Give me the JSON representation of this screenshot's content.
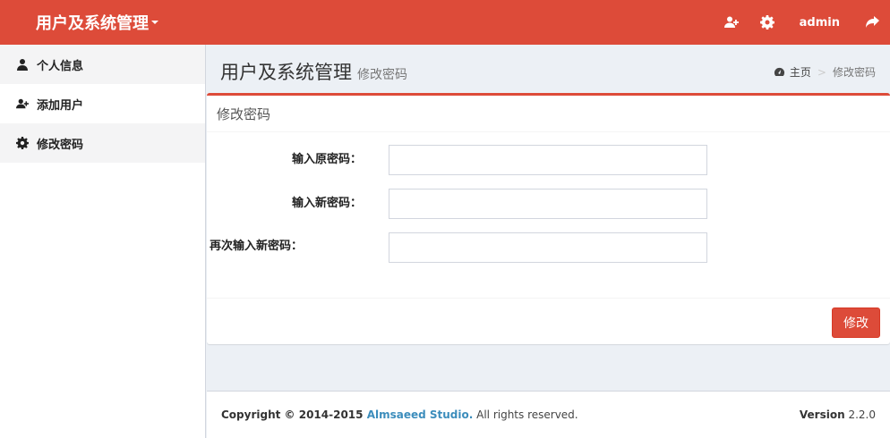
{
  "header": {
    "brand": "用户及系统管理",
    "user_name": "admin",
    "icons": [
      "add-user-icon",
      "gear-icon",
      "share-icon"
    ]
  },
  "sidebar": {
    "items": [
      {
        "label": "个人信息",
        "icon": "user-icon"
      },
      {
        "label": "添加用户",
        "icon": "user-plus-icon"
      },
      {
        "label": "修改密码",
        "icon": "gear-icon"
      }
    ]
  },
  "content": {
    "title": "用户及系统管理",
    "subtitle": "修改密码",
    "breadcrumb": {
      "home": "主页",
      "separator": ">",
      "current": "修改密码"
    }
  },
  "form": {
    "title": "修改密码",
    "fields": [
      {
        "label": "输入原密码：",
        "value": ""
      },
      {
        "label": "输入新密码：",
        "value": ""
      },
      {
        "label": "再次输入新密码：",
        "value": ""
      }
    ],
    "submit_label": "修改"
  },
  "footer": {
    "copyright_prefix": "Copyright © 2014-2015 ",
    "studio": "Almsaeed Studio.",
    "rights": " All rights reserved.",
    "version_label": "Version",
    "version": " 2.2.0"
  },
  "colors": {
    "accent": "#dd4b39",
    "link": "#3c8dbc",
    "background": "#ecf0f5"
  }
}
